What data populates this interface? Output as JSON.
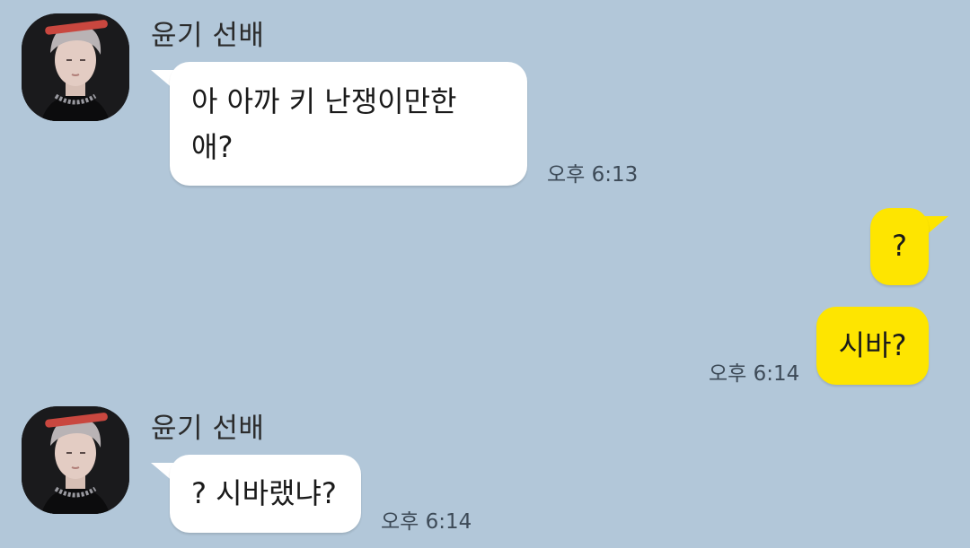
{
  "messages": [
    {
      "sender": "윤기 선배",
      "text": "아 아까 키 난쟁이만한\n애?",
      "time": "오후 6:13",
      "direction": "incoming"
    },
    {
      "text": "?",
      "direction": "outgoing"
    },
    {
      "text": "시바?",
      "time": "오후 6:14",
      "direction": "outgoing"
    },
    {
      "sender": "윤기 선배",
      "text": "? 시바랬냐?",
      "time": "오후 6:14",
      "direction": "incoming"
    }
  ],
  "colors": {
    "background": "#b2c7d9",
    "incoming_bubble": "#ffffff",
    "outgoing_bubble": "#fee500"
  }
}
